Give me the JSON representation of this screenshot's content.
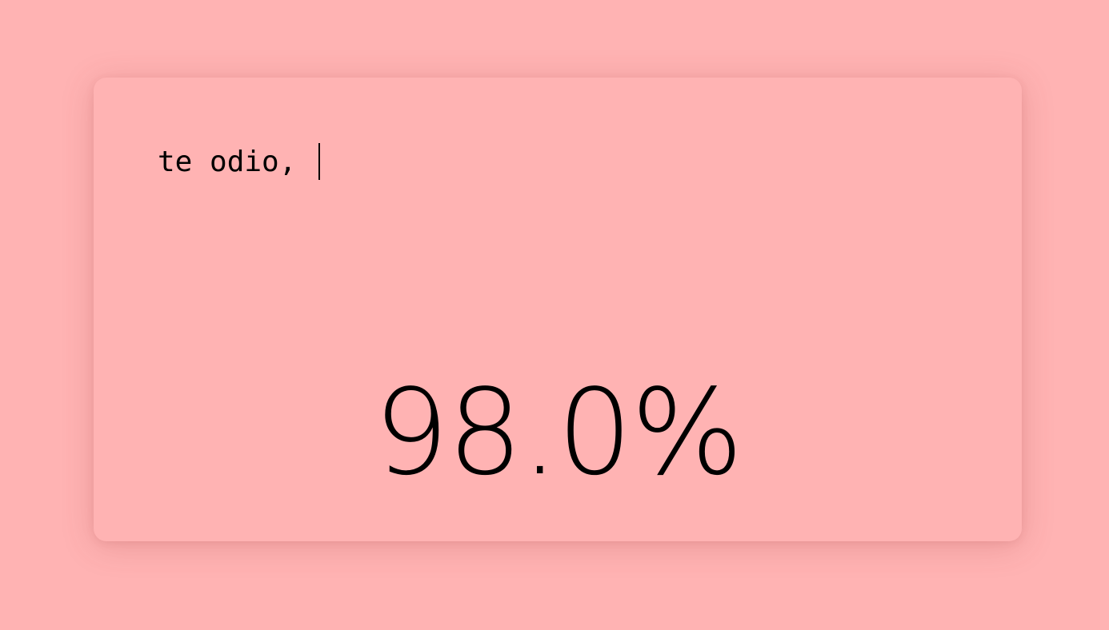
{
  "input": {
    "typed_text": "te odio, "
  },
  "result": {
    "percentage_label": "98.0%"
  },
  "colors": {
    "background": "#ffb3b3",
    "text": "#000000"
  }
}
